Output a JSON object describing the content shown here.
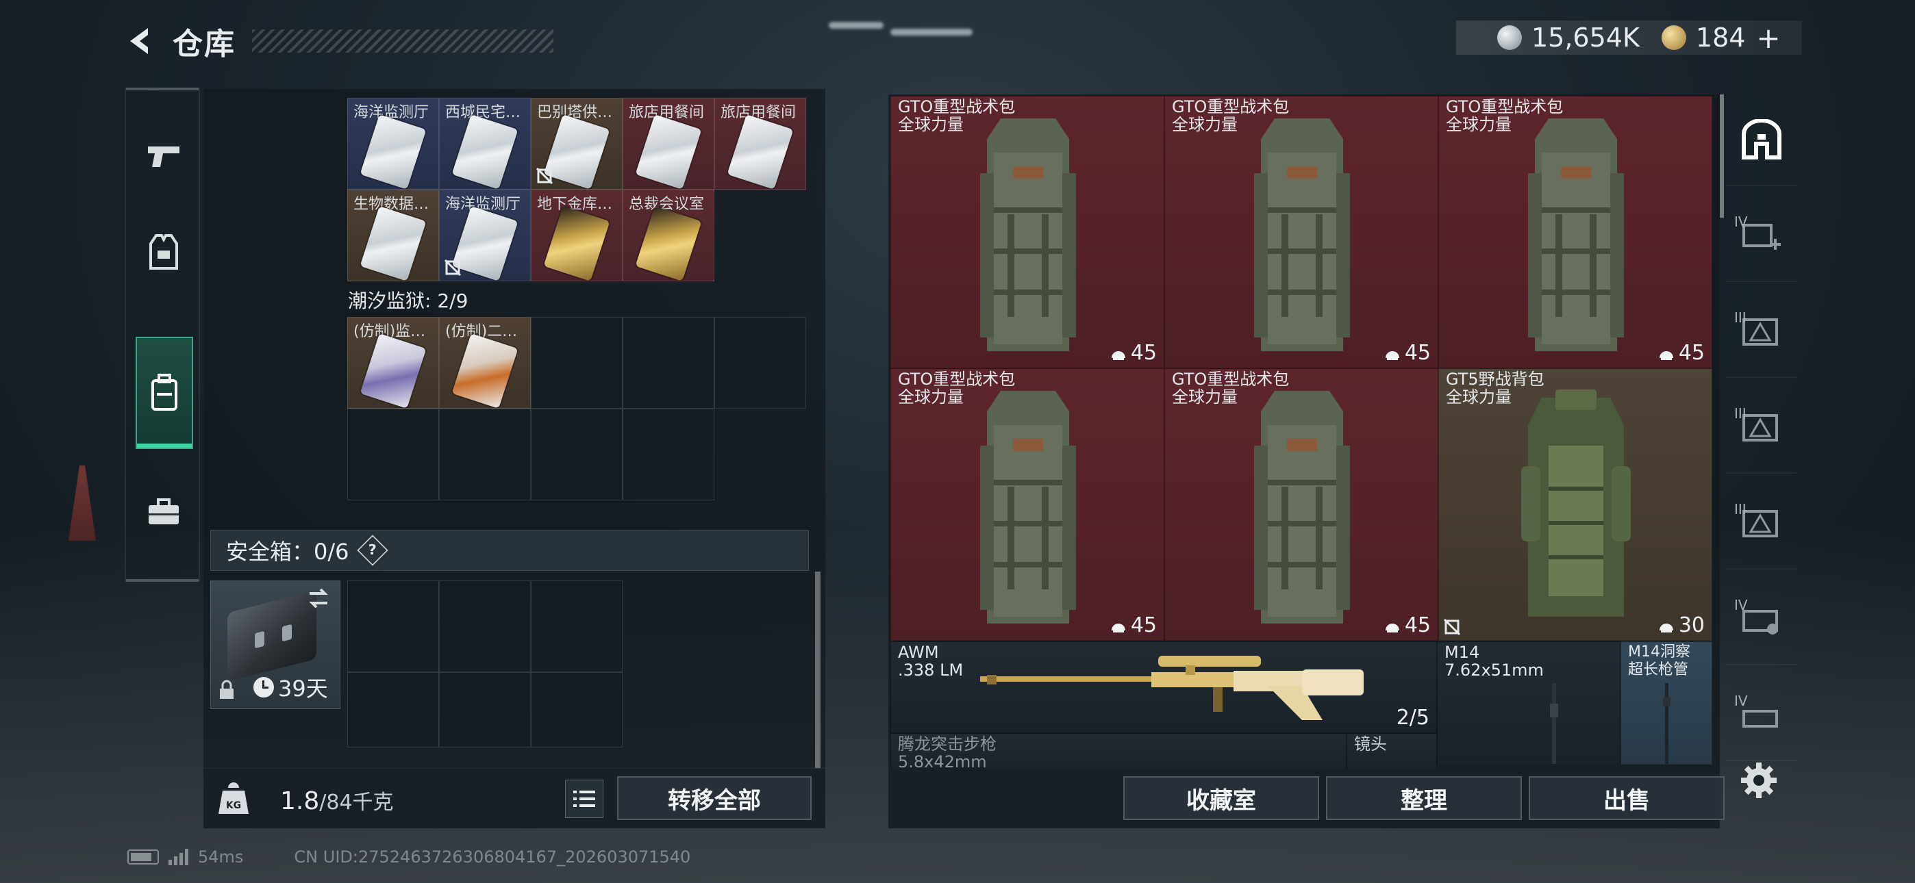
{
  "header": {
    "title": "仓库"
  },
  "currency": {
    "silver_amount": "15,654K",
    "gold_amount": "184",
    "add_label": "+"
  },
  "left_categories": [
    {
      "icon": "pistol-icon"
    },
    {
      "icon": "armor-vest-icon"
    },
    {
      "icon": "backpack-icon",
      "active": true
    },
    {
      "icon": "toolbox-icon"
    }
  ],
  "keycards_row1": [
    {
      "name": "海洋监测厅",
      "rarity": "blue"
    },
    {
      "name": "西城民宅…",
      "rarity": "blue"
    },
    {
      "name": "巴别塔供…",
      "rarity": "brown",
      "unsellable": true
    },
    {
      "name": "旅店用餐间",
      "rarity": "red"
    },
    {
      "name": "旅店用餐间",
      "rarity": "red"
    }
  ],
  "keycards_row2": [
    {
      "name": "生物数据…",
      "rarity": "brown"
    },
    {
      "name": "海洋监测厅",
      "rarity": "blue",
      "unsellable": true
    },
    {
      "name": "地下金库…",
      "rarity": "red",
      "gold": true
    },
    {
      "name": "总裁会议室",
      "rarity": "red",
      "gold": true
    }
  ],
  "section": {
    "label": "潮汐监狱: 2/9"
  },
  "prison_cards": [
    {
      "name": "(仿制)监…",
      "variant": "purple"
    },
    {
      "name": "(仿制)二…",
      "variant": "orange"
    }
  ],
  "safebox": {
    "label": "安全箱：0/6",
    "help": "?",
    "days": "39天"
  },
  "weight": {
    "current": "1.8",
    "max": "/84千克"
  },
  "buttons": {
    "transfer_all": "转移全部",
    "collection": "收藏室",
    "organize": "整理",
    "sell": "出售"
  },
  "stash_items": [
    {
      "name": "GTO重型战术包\n全球力量",
      "count": "45",
      "color": "red"
    },
    {
      "name": "GTO重型战术包\n全球力量",
      "count": "45",
      "color": "red"
    },
    {
      "name": "GTO重型战术包\n全球力量",
      "count": "45",
      "color": "red"
    },
    {
      "name": "GTO重型战术包\n全球力量",
      "count": "45",
      "color": "red"
    },
    {
      "name": "GTO重型战术包\n全球力量",
      "count": "45",
      "color": "red"
    },
    {
      "name": "GT5野战背包\n全球力量",
      "count": "30",
      "color": "brown",
      "unsellable": true
    }
  ],
  "weapons": [
    {
      "name": "AWM\n.338 LM",
      "count": "2/5"
    },
    {
      "name": "M14\n7.62x51mm"
    },
    {
      "name": "M14洞察\n超长枪管"
    },
    {
      "name": "腾龙突击步枪\n5.8x42mm"
    },
    {
      "name": "镜头"
    }
  ],
  "right_nav": [
    {
      "icon": "backpack-main-icon",
      "tier": ""
    },
    {
      "icon": "add-container-icon",
      "tier": "IV"
    },
    {
      "icon": "warning-container-icon",
      "tier": "III"
    },
    {
      "icon": "warning-container-icon",
      "tier": "III"
    },
    {
      "icon": "warning-container-icon",
      "tier": "III"
    },
    {
      "icon": "armor-container-icon",
      "tier": "IV"
    },
    {
      "icon": "container-icon",
      "tier": "IV"
    }
  ],
  "status": {
    "ping": "54ms",
    "uid": "CN UID:2752463726306804167_202603071540"
  }
}
